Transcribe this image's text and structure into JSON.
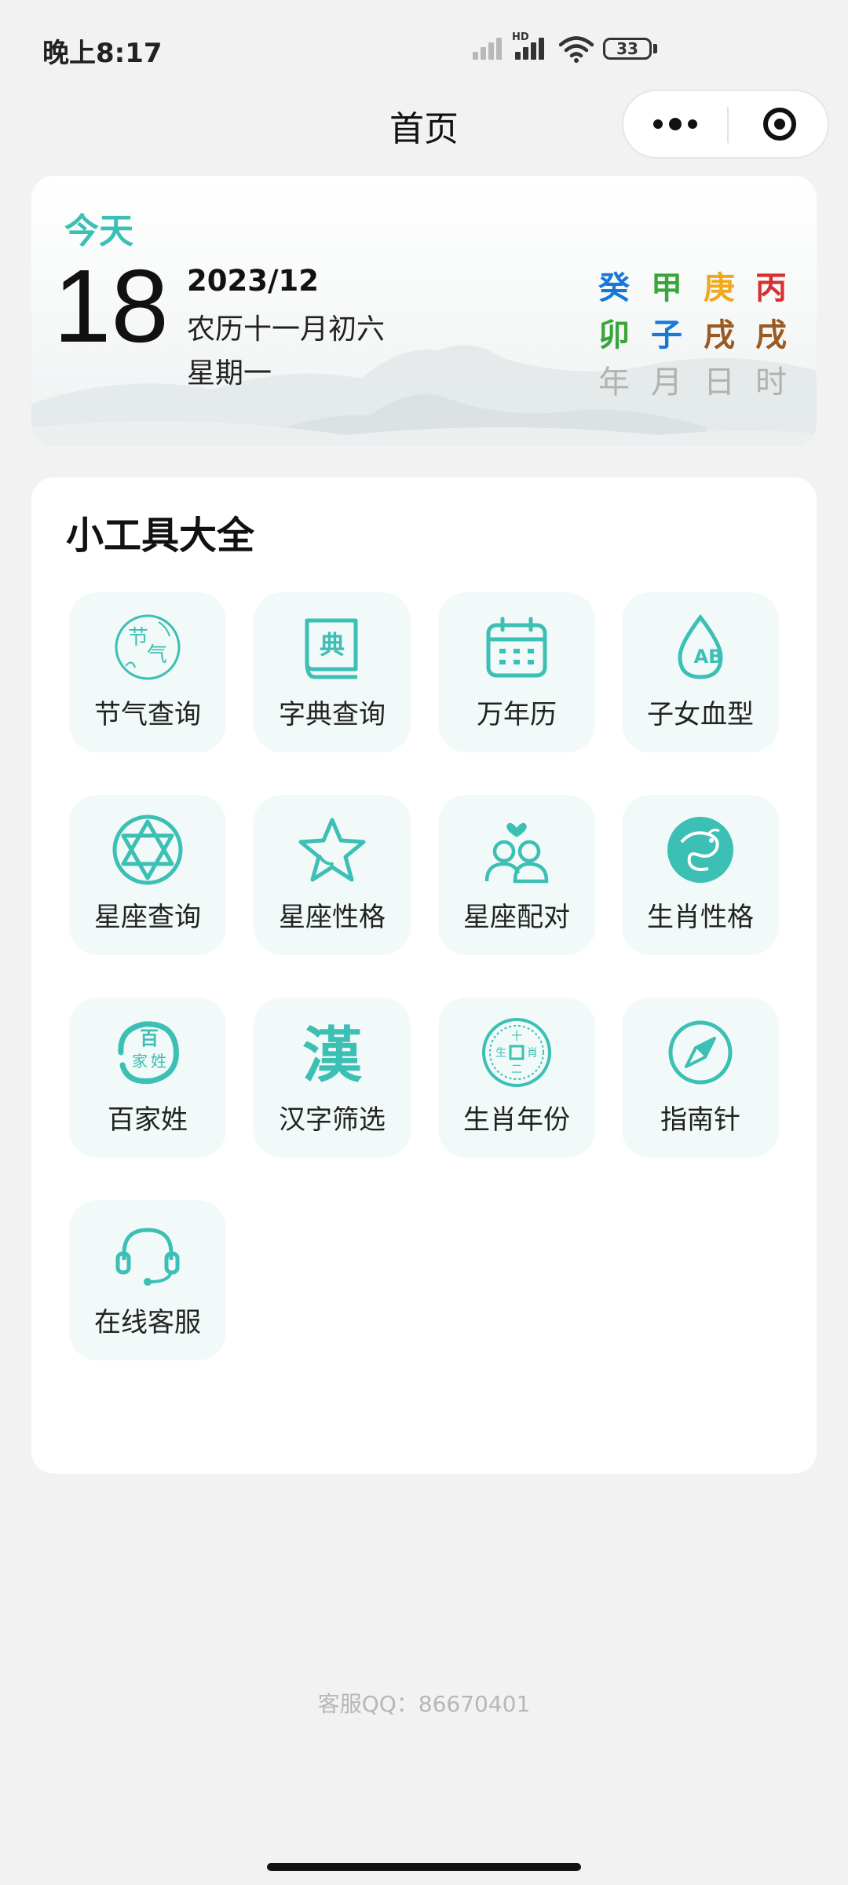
{
  "status_bar": {
    "time": "晚上8:17",
    "network_label": "HD",
    "battery": "33"
  },
  "nav": {
    "title": "首页"
  },
  "date_card": {
    "today_label": "今天",
    "day": "18",
    "year_month": "2023/12",
    "lunar": "农历十一月初六",
    "weekday": "星期一",
    "ganzhi": [
      {
        "stem": "癸",
        "branch": "卯",
        "label": "年"
      },
      {
        "stem": "甲",
        "branch": "子",
        "label": "月"
      },
      {
        "stem": "庚",
        "branch": "戌",
        "label": "日"
      },
      {
        "stem": "丙",
        "branch": "戌",
        "label": "时"
      }
    ],
    "ganzhi_colors": {
      "stems": [
        "#1778d8",
        "#3aa53a",
        "#f0a81c",
        "#d83030"
      ],
      "branches": [
        "#3aa53a",
        "#1778d8",
        "#9a5a22",
        "#9a5a22"
      ]
    }
  },
  "tools": {
    "title": "小工具大全",
    "accent": "#3cbfb4",
    "items": [
      {
        "label": "节气查询",
        "icon": "solar-term-icon"
      },
      {
        "label": "字典查询",
        "icon": "dictionary-book-icon"
      },
      {
        "label": "万年历",
        "icon": "calendar-icon"
      },
      {
        "label": "子女血型",
        "icon": "blood-type-drop-icon"
      },
      {
        "label": "星座查询",
        "icon": "hexagram-star-icon"
      },
      {
        "label": "星座性格",
        "icon": "star-outline-icon"
      },
      {
        "label": "星座配对",
        "icon": "couple-heart-icon"
      },
      {
        "label": "生肖性格",
        "icon": "dragon-emblem-icon"
      },
      {
        "label": "百家姓",
        "icon": "surname-seal-icon"
      },
      {
        "label": "汉字筛选",
        "icon": "han-character-icon"
      },
      {
        "label": "生肖年份",
        "icon": "zodiac-coin-icon"
      },
      {
        "label": "指南针",
        "icon": "compass-icon"
      },
      {
        "label": "在线客服",
        "icon": "headset-icon"
      }
    ],
    "icon_text": {
      "solar_term": [
        "节",
        "气"
      ],
      "dictionary": "典",
      "blood_type": "AB",
      "surname": [
        "百",
        "家",
        "姓"
      ],
      "han": "漢",
      "zodiac_coin": [
        "十",
        "二",
        "生",
        "肖"
      ]
    }
  },
  "footer": {
    "service_qq": "客服QQ：86670401"
  }
}
